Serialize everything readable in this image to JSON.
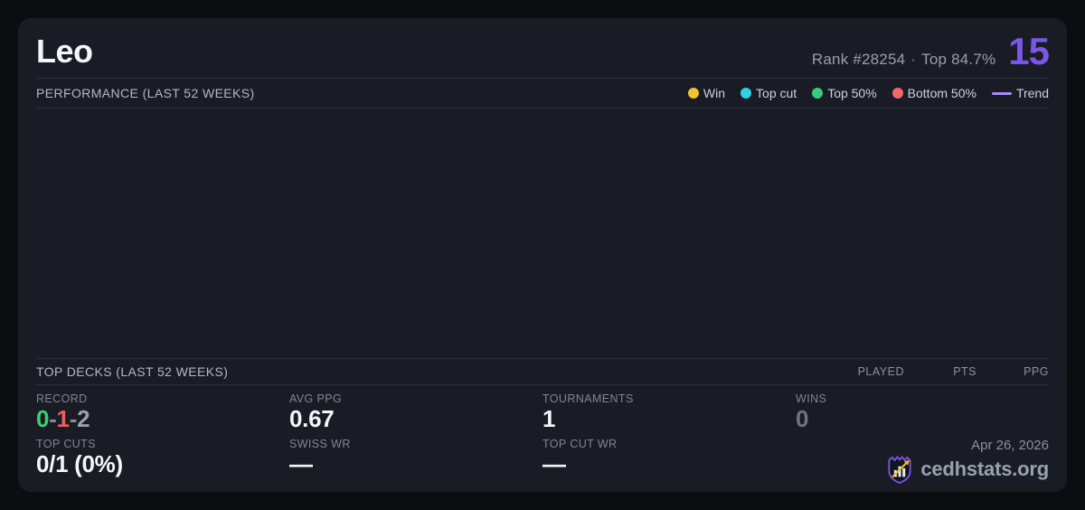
{
  "card": {
    "title": "Leo",
    "rank_text": "Rank #28254",
    "separator": "·",
    "top_percent": "Top 84.7%",
    "score": "15",
    "score_color": "#7b57e9"
  },
  "performance": {
    "heading": "PERFORMANCE (LAST 52 WEEKS)",
    "legend": [
      {
        "label": "Win",
        "color": "#f2c230",
        "type": "dot"
      },
      {
        "label": "Top cut",
        "color": "#2fd0e8",
        "type": "dot"
      },
      {
        "label": "Top 50%",
        "color": "#38cb7d",
        "type": "dot"
      },
      {
        "label": "Bottom 50%",
        "color": "#f2696c",
        "type": "dot"
      },
      {
        "label": "Trend",
        "color": "#a78bfa",
        "type": "line"
      }
    ]
  },
  "chart_data": {
    "type": "scatter",
    "title": "PERFORMANCE (LAST 52 WEEKS)",
    "points": [],
    "note": "chart area is empty - no events plotted in last 52 weeks"
  },
  "top_decks": {
    "heading": "TOP DECKS (LAST 52 WEEKS)",
    "columns": [
      "PLAYED",
      "PTS",
      "PPG"
    ],
    "rows": []
  },
  "stats": {
    "record": {
      "label": "RECORD",
      "wins": "0",
      "losses": "1",
      "draws": "2",
      "sep": "-",
      "win_color": "#3ecf70",
      "loss_color": "#ef5d5f",
      "draw_color": "#9aa1ae",
      "sep_color": "#848b99"
    },
    "avg_ppg": {
      "label": "AVG PPG",
      "value": "0.67"
    },
    "tournaments": {
      "label": "TOURNAMENTS",
      "value": "1"
    },
    "wins": {
      "label": "WINS",
      "value": "0"
    },
    "top_cuts": {
      "label": "TOP CUTS",
      "value": "0/1 (0%)"
    },
    "swiss_wr": {
      "label": "SWISS WR",
      "value": "—"
    },
    "top_cut_wr": {
      "label": "TOP CUT WR",
      "value": "—"
    }
  },
  "footer": {
    "date": "Apr 26, 2026",
    "site": "cedhstats.org",
    "logo": {
      "shield_color": "#7d52e8",
      "bars_color": "#e6e9f0",
      "arrow_color": "#f2c51d"
    }
  }
}
